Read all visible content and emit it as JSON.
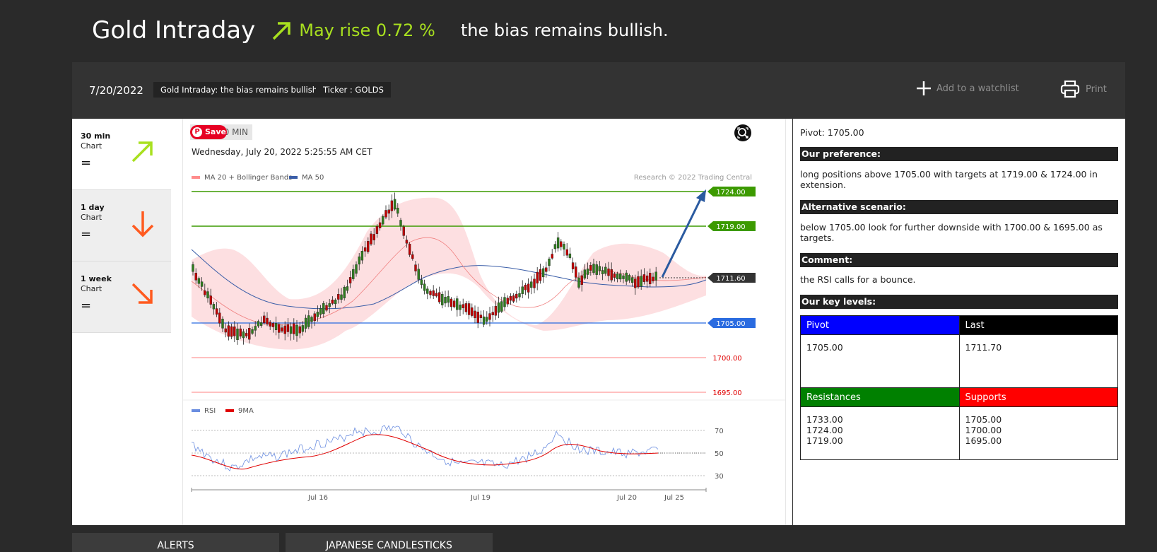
{
  "headline": {
    "title": "Gold Intraday",
    "rise_text": "May rise 0.72 %",
    "bias_text": "the bias remains bullish."
  },
  "toolbar": {
    "date": "7/20/2022",
    "tag_title": "Gold Intraday: the bias remains bullish.",
    "tag_ticker": "Ticker : GOLDS",
    "watchlist_label": "Add to a watchlist",
    "print_label": "Print"
  },
  "timeframes": [
    {
      "label": "30 min",
      "sub": "Chart",
      "status": "=",
      "direction": "up"
    },
    {
      "label": "1 day",
      "sub": "Chart",
      "status": "=",
      "direction": "down"
    },
    {
      "label": "1 week",
      "sub": "Chart",
      "status": "=",
      "direction": "down-right"
    }
  ],
  "chart": {
    "save_label": "Save",
    "timeframe_label": "0 MIN",
    "datetime": "Wednesday, July 20, 2022 5:25:55 AM CET",
    "legend_ma20": "MA 20 + Bollinger Bands",
    "legend_ma50": "MA 50",
    "credit": "Research © 2022 Trading Central",
    "legend_rsi": "RSI",
    "legend_9ma": "9MA",
    "rsi_ticks": [
      "70",
      "50",
      "30"
    ],
    "x_labels": [
      "Jul 16",
      "Jul 19",
      "Jul 20",
      "Jul 25"
    ],
    "level_labels": {
      "r2": "1724.00",
      "r1": "1719.00",
      "last": "1711.60",
      "pivot": "1705.00",
      "s1": "1700.00",
      "s2": "1695.00"
    }
  },
  "chart_data": {
    "type": "candlestick",
    "title": "",
    "levels": [
      {
        "name": "Resistance 2",
        "value": 1724.0,
        "color": "#3c9a00"
      },
      {
        "name": "Resistance 1",
        "value": 1719.0,
        "color": "#3c9a00"
      },
      {
        "name": "Last",
        "value": 1711.6,
        "color": "#333333"
      },
      {
        "name": "Pivot",
        "value": 1705.0,
        "color": "#2a6be0"
      },
      {
        "name": "Support 1",
        "value": 1700.0,
        "color": "#ff8080"
      },
      {
        "name": "Support 2",
        "value": 1695.0,
        "color": "#ff8080"
      }
    ],
    "y_range": [
      1690,
      1728
    ],
    "rsi_ticks": [
      70,
      50,
      30
    ],
    "x_tick_labels": [
      "Jul 16",
      "Jul 19",
      "Jul 20",
      "Jul 25"
    ],
    "forecast_target": 1724.0
  },
  "analysis": {
    "pivot_line": "Pivot: 1705.00",
    "preference_header": "Our preference:",
    "preference_text": "long positions above 1705.00 with targets at 1719.00 & 1724.00 in extension.",
    "alternative_header": "Alternative scenario:",
    "alternative_text": "below 1705.00 look for further downside with 1700.00 & 1695.00 as targets.",
    "comment_header": "Comment:",
    "comment_text": "the RSI calls for a bounce.",
    "key_levels_header": "Our key levels:",
    "table": {
      "pivot_h": "Pivot",
      "last_h": "Last",
      "pivot_v": "1705.00",
      "last_v": "1711.70",
      "res_h": "Resistances",
      "sup_h": "Supports",
      "res": [
        "1733.00",
        "1724.00",
        "1719.00"
      ],
      "sup": [
        "1705.00",
        "1700.00",
        "1695.00"
      ]
    }
  },
  "colors": {
    "accent_green": "#a8e01f",
    "arrow_down": "#ff5a1f",
    "pivot_blue": "#0000ff",
    "res_green": "#008000",
    "sup_red": "#ff0000"
  },
  "bottom_buttons": {
    "alerts": "ALERTS",
    "candles": "JAPANESE CANDLESTICKS"
  }
}
